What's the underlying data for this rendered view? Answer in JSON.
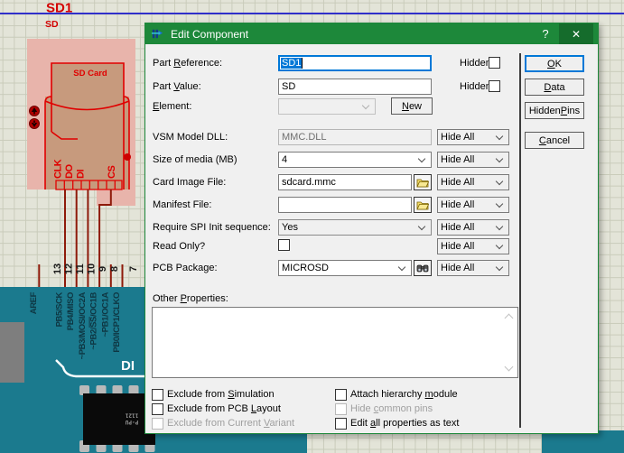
{
  "window": {
    "title": "Edit Component",
    "help": "?",
    "close": "✕"
  },
  "fields": {
    "part_reference": {
      "label": {
        "t": "Part Reference:",
        "k": "R"
      },
      "value": "SD1",
      "hidden_label": "Hidden:"
    },
    "part_value": {
      "label": {
        "t": "Part Value:",
        "k": "V"
      },
      "value": "SD",
      "hidden_label": "Hidden:"
    },
    "element": {
      "label": {
        "t": "Element:",
        "k": "E"
      },
      "value": "",
      "new_button": {
        "t": "New",
        "k": "N"
      }
    },
    "vsm_model_dll": {
      "label": "VSM Model DLL:",
      "value": "MMC.DLL"
    },
    "size_of_media": {
      "label": "Size of media (MB)",
      "value": "4"
    },
    "card_image_file": {
      "label": "Card Image File:",
      "value": "sdcard.mmc"
    },
    "manifest_file": {
      "label": "Manifest File:",
      "value": ""
    },
    "require_spi": {
      "label": "Require SPI Init sequence:",
      "value": "Yes"
    },
    "read_only": {
      "label": "Read Only?",
      "checked": false
    },
    "pcb_package": {
      "label": "PCB Package:",
      "value": "MICROSD"
    },
    "other_properties": {
      "label": {
        "t": "Other Properties:",
        "k": "P"
      },
      "value": ""
    }
  },
  "hide_all_label": "Hide All",
  "side_buttons": {
    "ok": {
      "t": "OK",
      "k": "O"
    },
    "data": {
      "t": "Data",
      "k": "D"
    },
    "hidden_pins": {
      "t": "Hidden Pins",
      "k": "P"
    },
    "cancel": {
      "t": "Cancel",
      "k": "C"
    }
  },
  "footer_checks": {
    "left": [
      {
        "label": {
          "t": "Exclude from Simulation",
          "k": "S"
        },
        "checked": false,
        "disabled": false
      },
      {
        "label": {
          "t": "Exclude from PCB Layout",
          "k": "L"
        },
        "checked": false,
        "disabled": false
      },
      {
        "label": {
          "t": "Exclude from Current Variant",
          "k": "V"
        },
        "checked": false,
        "disabled": true
      }
    ],
    "right": [
      {
        "label": {
          "t": "Attach hierarchy module",
          "k": "m"
        },
        "checked": false,
        "disabled": false
      },
      {
        "label": {
          "t": "Hide common pins",
          "k": "c"
        },
        "checked": false,
        "disabled": true
      },
      {
        "label": {
          "t": "Edit all properties as text",
          "k": "a"
        },
        "checked": false,
        "disabled": false
      }
    ]
  },
  "schematic": {
    "ref": "SD1",
    "value": "SD",
    "card_title": "SD Card",
    "card_pins": [
      "CLK",
      "DO",
      "DI",
      "CS"
    ],
    "pin_numbers": [
      "13",
      "12",
      "11",
      "10",
      "9",
      "8",
      "7"
    ],
    "board_labels": [
      "AREF",
      "PB5/SCK",
      "PB4/MISO",
      "~PB3/MOSI/OC2A",
      {
        "pre": "~PB2/",
        "over": "SS",
        "post": "/OC1B"
      },
      "~PB1/OC1A",
      "PB0/ICP1/CLKO"
    ],
    "board_text": "DI",
    "chip_text": [
      "P-PU",
      "1121"
    ]
  },
  "colors": {
    "titlebar_green": "#1d883a",
    "accent_blue": "#0078d7",
    "board_teal": "#1b7a8e",
    "wire_dark_red": "#8e1a0a",
    "symbol_red": "#e00000",
    "selection_pink": "#e8b4ab",
    "card_tan": "#c79a7d",
    "sheet_border_blue": "#2020cc"
  }
}
